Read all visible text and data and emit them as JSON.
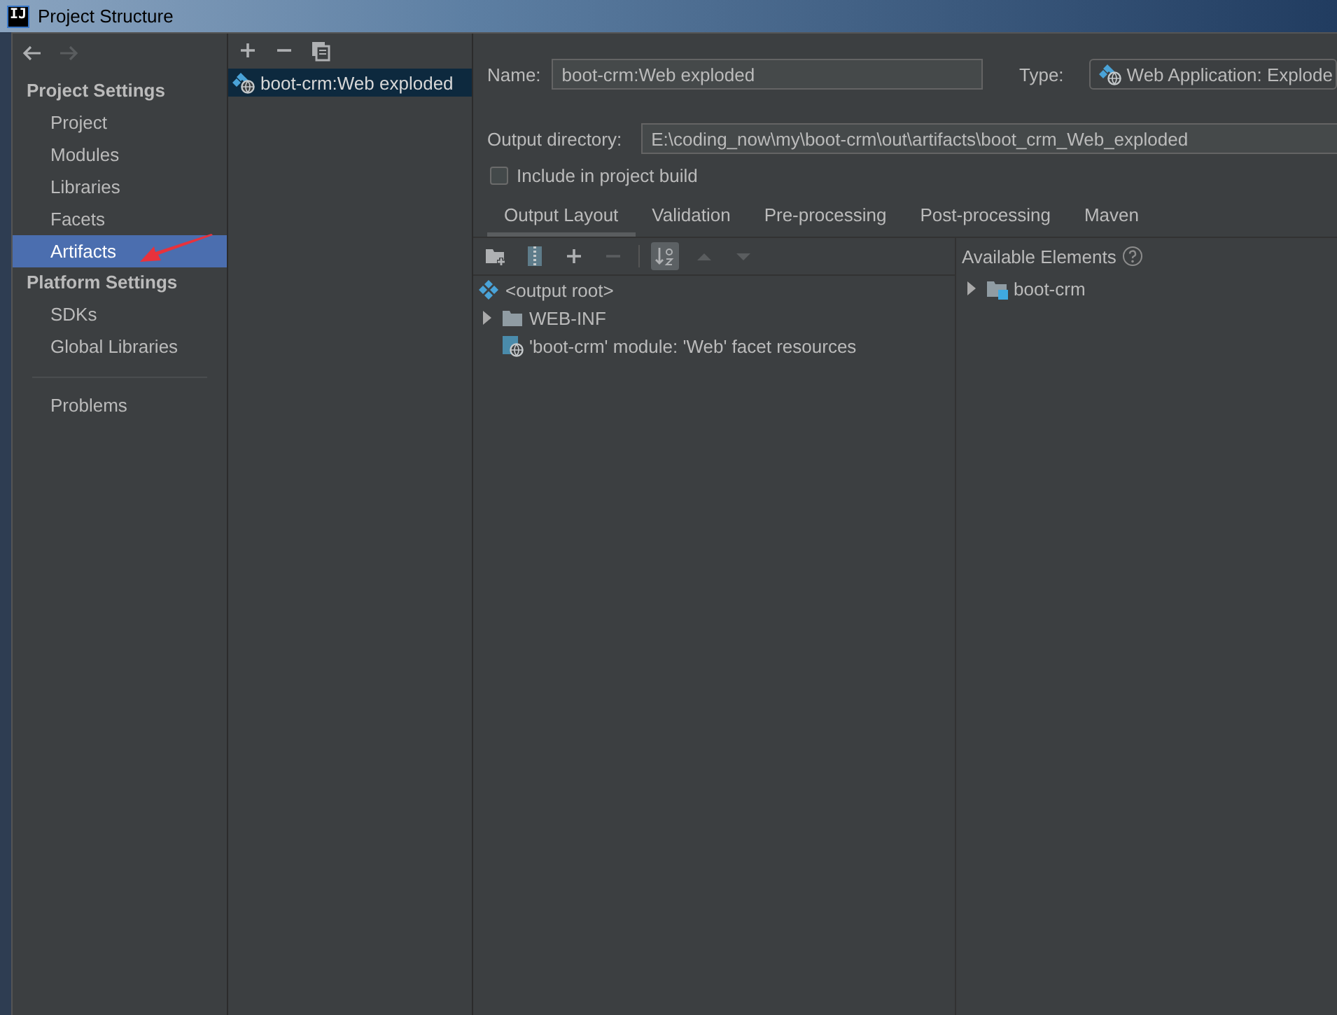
{
  "window": {
    "logo": "IJ",
    "title": "Project Structure"
  },
  "sidebar": {
    "nav": [
      {
        "kind": "back",
        "disabled": false
      },
      {
        "kind": "forward",
        "disabled": true
      }
    ],
    "sections": [
      {
        "heading": "Project Settings",
        "items": [
          {
            "label": "Project",
            "selected": false
          },
          {
            "label": "Modules",
            "selected": false
          },
          {
            "label": "Libraries",
            "selected": false
          },
          {
            "label": "Facets",
            "selected": false
          },
          {
            "label": "Artifacts",
            "selected": true
          }
        ]
      },
      {
        "heading": "Platform Settings",
        "items": [
          {
            "label": "SDKs",
            "selected": false
          },
          {
            "label": "Global Libraries",
            "selected": false
          }
        ]
      }
    ],
    "footer_items": [
      {
        "label": "Problems",
        "selected": false
      }
    ]
  },
  "artifacts": {
    "toolbar": [
      {
        "kind": "add"
      },
      {
        "kind": "remove"
      },
      {
        "kind": "copy"
      }
    ],
    "items": [
      {
        "label": "boot-crm:Web exploded",
        "selected": true
      }
    ]
  },
  "editor": {
    "name_label": "Name:",
    "name": "boot-crm:Web exploded",
    "type_label": "Type:",
    "type": "Web Application: Explode",
    "output_label": "Output directory:",
    "output": "E:\\coding_now\\my\\boot-crm\\out\\artifacts\\boot_crm_Web_exploded",
    "include_build": {
      "label": "Include in project build",
      "checked": false
    },
    "tabs": [
      {
        "label": "Output Layout",
        "selected": true
      },
      {
        "label": "Validation",
        "selected": false
      },
      {
        "label": "Pre-processing",
        "selected": false
      },
      {
        "label": "Post-processing",
        "selected": false
      },
      {
        "label": "Maven",
        "selected": false
      }
    ],
    "toolbar": [
      {
        "kind": "new-folder",
        "disabled": false,
        "on": false
      },
      {
        "kind": "archive",
        "disabled": false,
        "on": false
      },
      {
        "kind": "add",
        "disabled": false,
        "on": false
      },
      {
        "kind": "remove",
        "disabled": true,
        "on": false
      },
      {
        "kind": "sort",
        "disabled": false,
        "on": true
      },
      {
        "kind": "up",
        "disabled": true,
        "on": false
      },
      {
        "kind": "down",
        "disabled": true,
        "on": false
      }
    ],
    "layout_tree": [
      {
        "label": "<output root>",
        "kind": "root",
        "children": [
          {
            "label": "WEB-INF",
            "kind": "folder",
            "expanded": false
          },
          {
            "label": "'boot-crm' module: 'Web' facet resources",
            "kind": "facet"
          }
        ]
      }
    ],
    "available_label": "Available Elements",
    "available_tree": [
      {
        "label": "boot-crm",
        "kind": "module",
        "expanded": false
      }
    ]
  }
}
